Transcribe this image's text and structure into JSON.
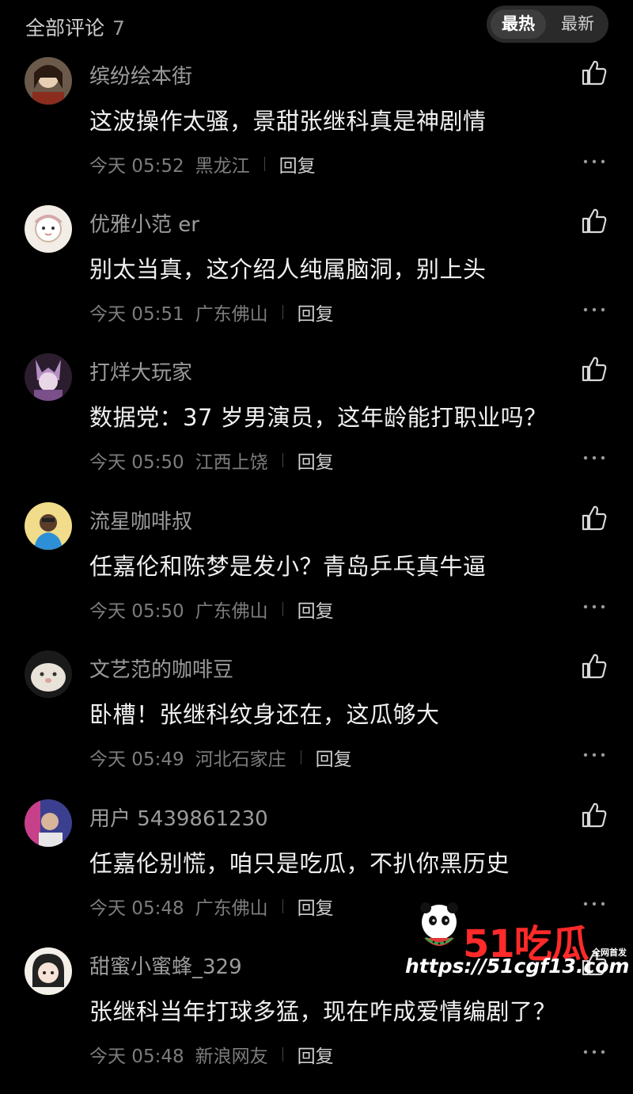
{
  "header": {
    "title": "全部评论",
    "count": "7",
    "sort_tabs": [
      "最热",
      "最新"
    ]
  },
  "comments": [
    {
      "username": "缤纷绘本街",
      "content": "这波操作太骚，景甜张继科真是神剧情",
      "time": "今天 05:52",
      "location": "黑龙江",
      "reply": "回复"
    },
    {
      "username": "优雅小范 er",
      "content": "别太当真，这介绍人纯属脑洞，别上头",
      "time": "今天 05:51",
      "location": "广东佛山",
      "reply": "回复"
    },
    {
      "username": "打烊大玩家",
      "content": "数据党：37 岁男演员，这年龄能打职业吗？",
      "time": "今天 05:50",
      "location": "江西上饶",
      "reply": "回复"
    },
    {
      "username": "流星咖啡叔",
      "content": "任嘉伦和陈梦是发小？青岛乒乓真牛逼",
      "time": "今天 05:50",
      "location": "广东佛山",
      "reply": "回复"
    },
    {
      "username": "文艺范的咖啡豆",
      "content": "卧槽！张继科纹身还在，这瓜够大",
      "time": "今天 05:49",
      "location": "河北石家庄",
      "reply": "回复"
    },
    {
      "username": "用户 5439861230",
      "content": "任嘉伦别慌，咱只是吃瓜，不扒你黑历史",
      "time": "今天 05:48",
      "location": "广东佛山",
      "reply": "回复"
    },
    {
      "username": "甜蜜小蜜蜂_329",
      "content": "张继科当年打球多猛，现在咋成爱情编剧了？",
      "time": "今天 05:48",
      "location": "新浪网友",
      "reply": "回复"
    }
  ],
  "watermark": {
    "logo_text": "51吃瓜",
    "tag": "全网首发",
    "url": "https://51cgf13.com"
  },
  "icons": {
    "like": "thumbs-up-icon",
    "more": "more-dots-icon"
  },
  "colors": {
    "background": "#000000",
    "watermark_red": "#ff2a2a"
  }
}
